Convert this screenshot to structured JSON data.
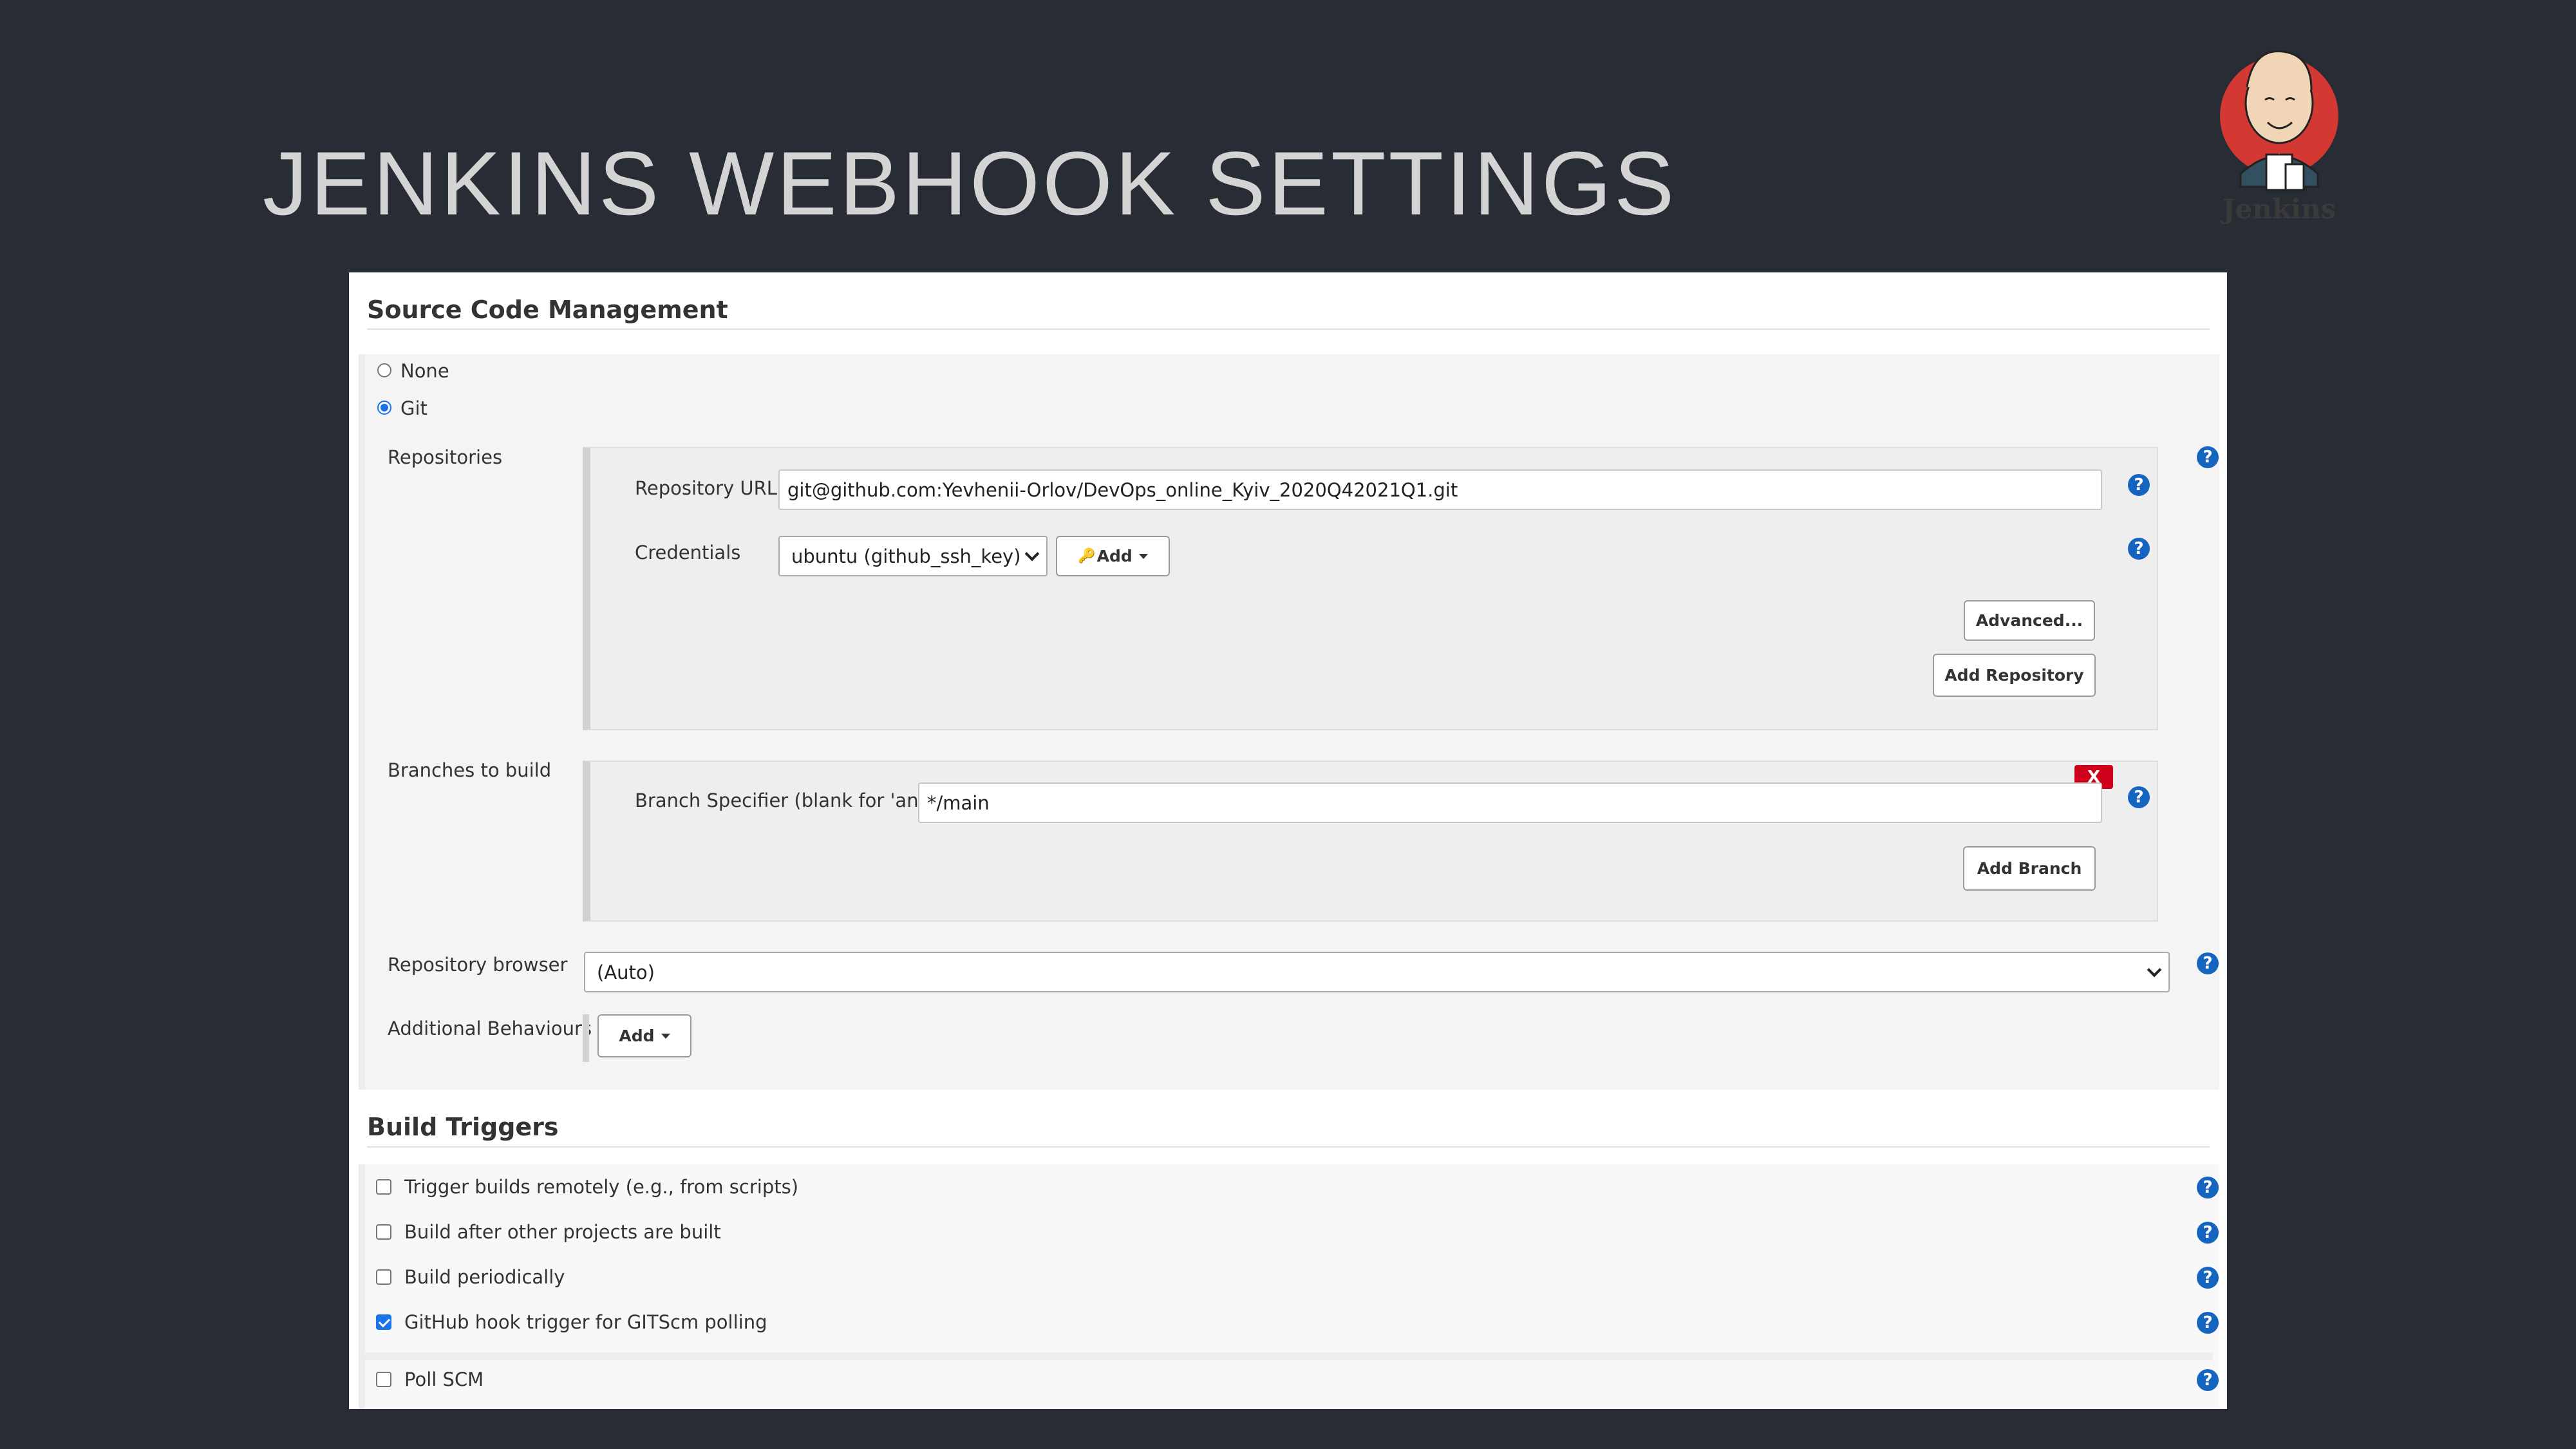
{
  "slide": {
    "title": "JENKINS WEBHOOK SETTINGS",
    "logo_text": "Jenkins",
    "logo_icon": "jenkins-butler-logo"
  },
  "scm": {
    "header": "Source Code Management",
    "options": [
      {
        "label": "None",
        "selected": false
      },
      {
        "label": "Git",
        "selected": true
      }
    ],
    "repositories_label": "Repositories",
    "repository_url_label": "Repository URL",
    "repository_url_value": "git@github.com:Yevhenii-Orlov/DevOps_online_Kyiv_2020Q42021Q1.git",
    "credentials_label": "Credentials",
    "credentials_value": "ubuntu (github_ssh_key)",
    "add_credentials_label": "Add",
    "advanced_label": "Advanced...",
    "add_repository_label": "Add Repository",
    "branches_label": "Branches to build",
    "branch_specifier_label": "Branch Specifier (blank for 'any')",
    "branch_specifier_value": "*/main",
    "delete_branch_label": "X",
    "add_branch_label": "Add Branch",
    "repository_browser_label": "Repository browser",
    "repository_browser_value": "(Auto)",
    "additional_behaviours_label": "Additional Behaviours",
    "add_behaviour_label": "Add"
  },
  "build_triggers": {
    "header": "Build Triggers",
    "items": [
      {
        "label": "Trigger builds remotely (e.g., from scripts)",
        "checked": false
      },
      {
        "label": "Build after other projects are built",
        "checked": false
      },
      {
        "label": "Build periodically",
        "checked": false
      },
      {
        "label": "GitHub hook trigger for GITScm polling",
        "checked": true
      },
      {
        "label": "Poll SCM",
        "checked": false
      }
    ]
  },
  "help_icon_glyph": "?",
  "colors": {
    "background": "#282c34",
    "help_icon": "#1565c0",
    "delete_button": "#d0021b",
    "checkbox_accent": "#1a73e8"
  }
}
